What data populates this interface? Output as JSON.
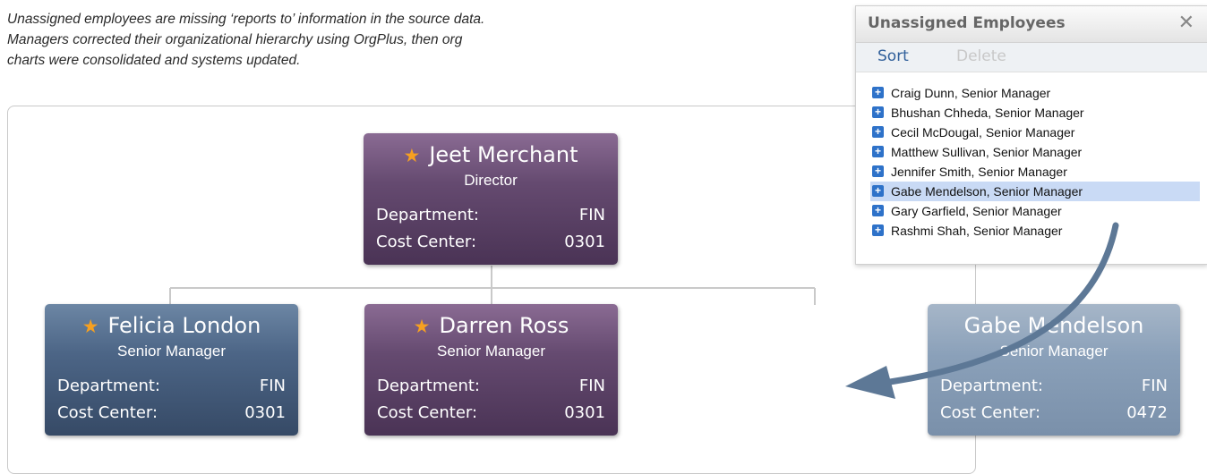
{
  "caption": {
    "line1": "Unassigned employees are missing ‘reports to’ information in the source data.",
    "line2": "Managers corrected their organizational hierarchy using OrgPlus, then org",
    "line3": "charts were consolidated and systems updated."
  },
  "colors": {
    "card_purple": "#654a70",
    "card_blue": "#4c6586",
    "card_ghost": "#8aa0b9",
    "star": "#f6a020",
    "arrow": "#5d7896",
    "selected_row": "#c9daf5",
    "plus_icon": "#2e72c9"
  },
  "cards": {
    "director": {
      "name": "Jeet Merchant",
      "title": "Director",
      "starred": true,
      "dept_label": "Department:",
      "dept_value": "FIN",
      "cc_label": "Cost Center:",
      "cc_value": "0301",
      "color": "purple"
    },
    "felicia": {
      "name": "Felicia London",
      "title": "Senior Manager",
      "starred": true,
      "dept_label": "Department:",
      "dept_value": "FIN",
      "cc_label": "Cost Center:",
      "cc_value": "0301",
      "color": "blue"
    },
    "darren": {
      "name": "Darren Ross",
      "title": "Senior Manager",
      "starred": true,
      "dept_label": "Department:",
      "dept_value": "FIN",
      "cc_label": "Cost Center:",
      "cc_value": "0301",
      "color": "purple"
    },
    "gabe": {
      "name": "Gabe Mendelson",
      "title": "Senior Manager",
      "starred": false,
      "dept_label": "Department:",
      "dept_value": "FIN",
      "cc_label": "Cost Center:",
      "cc_value": "0472",
      "color": "ghost"
    }
  },
  "panel": {
    "title": "Unassigned Employees",
    "close_icon": "close-icon",
    "sort_label": "Sort",
    "delete_label": "Delete",
    "employees": [
      "Craig Dunn, Senior Manager",
      "Bhushan Chheda, Senior Manager",
      "Cecil McDougal, Senior Manager",
      "Matthew Sullivan, Senior Manager",
      "Jennifer Smith, Senior Manager",
      "Gabe Mendelson, Senior Manager",
      "Gary Garfield, Senior Manager",
      "Rashmi Shah, Senior Manager"
    ],
    "selected_index": 5
  }
}
